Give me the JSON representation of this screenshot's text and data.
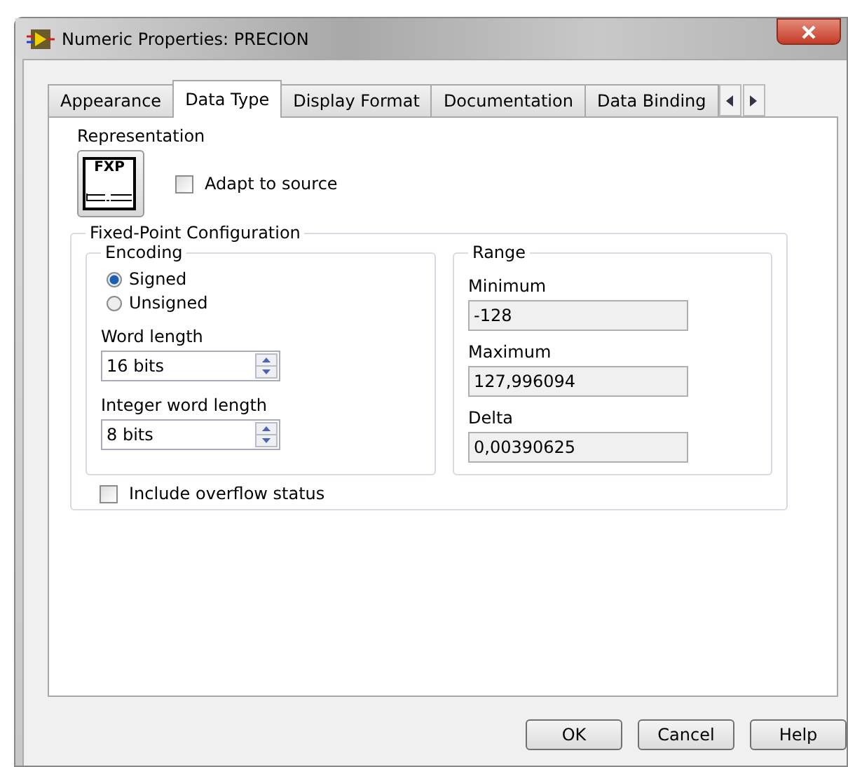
{
  "window": {
    "title": "Numeric Properties: PRECION"
  },
  "tabs": [
    {
      "label": "Appearance",
      "selected": false
    },
    {
      "label": "Data Type",
      "selected": true
    },
    {
      "label": "Display Format",
      "selected": false
    },
    {
      "label": "Documentation",
      "selected": false
    },
    {
      "label": "Data Binding",
      "selected": false
    }
  ],
  "representation": {
    "label": "Representation",
    "icon_text": "FXP"
  },
  "adapt_to_source": {
    "label": "Adapt to source",
    "checked": false
  },
  "fixed_point": {
    "title": "Fixed-Point Configuration",
    "encoding": {
      "title": "Encoding",
      "options": [
        {
          "label": "Signed",
          "selected": true
        },
        {
          "label": "Unsigned",
          "selected": false
        }
      ],
      "word_length": {
        "label": "Word length",
        "value": "16 bits"
      },
      "integer_word_length": {
        "label": "Integer word length",
        "value": "8 bits"
      }
    },
    "range": {
      "title": "Range",
      "fields": [
        {
          "label": "Minimum",
          "value": "-128"
        },
        {
          "label": "Maximum",
          "value": "127,996094"
        },
        {
          "label": "Delta",
          "value": "0,00390625"
        }
      ]
    },
    "include_overflow_status": {
      "label": "Include overflow status",
      "checked": false
    }
  },
  "buttons": [
    "OK",
    "Cancel",
    "Help"
  ]
}
